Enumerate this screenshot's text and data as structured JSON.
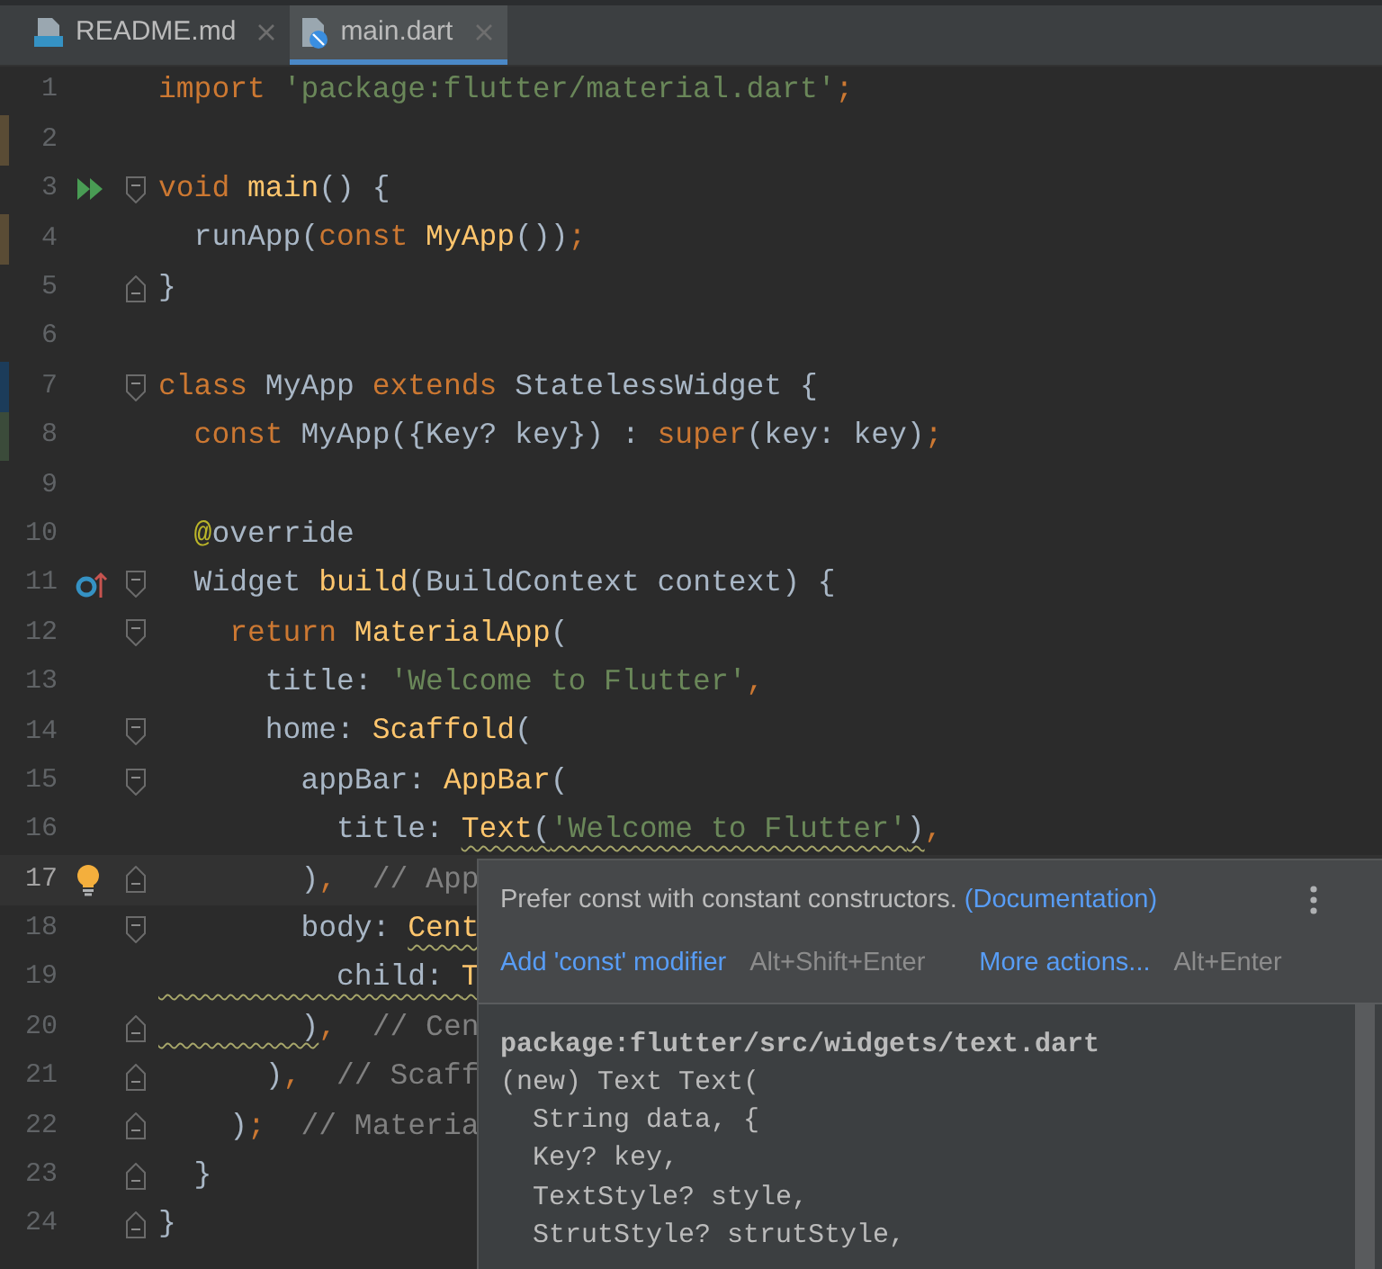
{
  "tabs": [
    {
      "label": "README.md",
      "kind": "markdown",
      "selected": false
    },
    {
      "label": "main.dart",
      "kind": "dart",
      "selected": true
    }
  ],
  "editor": {
    "lines": [
      {
        "number": "1",
        "current": false,
        "tokens": [
          {
            "text": "import ",
            "kind": "keyword"
          },
          {
            "text": "'package:flutter/material.dart'",
            "kind": "string"
          },
          {
            "text": ";",
            "kind": "keyword"
          }
        ]
      },
      {
        "number": "2",
        "current": false,
        "change_marker": {
          "color": "#5a4c35"
        }
      },
      {
        "number": "3",
        "current": false,
        "gutter_icon": {
          "kind": "run"
        },
        "fold_marker": {
          "kind": "open"
        },
        "tokens": [
          {
            "text": "void ",
            "kind": "keyword"
          },
          {
            "text": "main",
            "kind": "call"
          },
          {
            "text": "() {",
            "kind": "plain"
          }
        ]
      },
      {
        "number": "4",
        "current": false,
        "change_marker": {
          "color": "#5a4c35"
        },
        "tokens": [
          {
            "text": "  runApp(",
            "kind": "plain"
          },
          {
            "text": "const ",
            "kind": "keyword"
          },
          {
            "text": "MyApp",
            "kind": "call"
          },
          {
            "text": "())",
            "kind": "plain"
          },
          {
            "text": ";",
            "kind": "keyword"
          }
        ]
      },
      {
        "number": "5",
        "current": false,
        "fold_marker": {
          "kind": "close"
        },
        "tokens": [
          {
            "text": "}",
            "kind": "plain"
          }
        ]
      },
      {
        "number": "6",
        "current": false
      },
      {
        "number": "7",
        "current": false,
        "change_marker": {
          "color": "#1c3c5a"
        },
        "fold_marker": {
          "kind": "open"
        },
        "tokens": [
          {
            "text": "class ",
            "kind": "keyword"
          },
          {
            "text": "MyApp ",
            "kind": "plain"
          },
          {
            "text": "extends ",
            "kind": "keyword"
          },
          {
            "text": "StatelessWidget {",
            "kind": "plain"
          }
        ]
      },
      {
        "number": "8",
        "current": false,
        "change_marker": {
          "color": "#3b4b3a"
        },
        "tokens": [
          {
            "text": "  const ",
            "kind": "keyword"
          },
          {
            "text": "MyApp({Key? key}) : ",
            "kind": "plain"
          },
          {
            "text": "super",
            "kind": "keyword"
          },
          {
            "text": "(key: key)",
            "kind": "plain"
          },
          {
            "text": ";",
            "kind": "keyword"
          }
        ]
      },
      {
        "number": "9",
        "current": false
      },
      {
        "number": "10",
        "current": false,
        "tokens": [
          {
            "text": "  @",
            "kind": "annotation"
          },
          {
            "text": "override",
            "kind": "plain"
          }
        ]
      },
      {
        "number": "11",
        "current": false,
        "gutter_icon": {
          "kind": "override"
        },
        "fold_marker": {
          "kind": "open"
        },
        "tokens": [
          {
            "text": "  Widget ",
            "kind": "plain"
          },
          {
            "text": "build",
            "kind": "call"
          },
          {
            "text": "(BuildContext context) {",
            "kind": "plain"
          }
        ]
      },
      {
        "number": "12",
        "current": false,
        "fold_marker": {
          "kind": "open"
        },
        "tokens": [
          {
            "text": "    return ",
            "kind": "keyword"
          },
          {
            "text": "MaterialApp",
            "kind": "call"
          },
          {
            "text": "(",
            "kind": "plain"
          }
        ]
      },
      {
        "number": "13",
        "current": false,
        "tokens": [
          {
            "text": "      title: ",
            "kind": "plain"
          },
          {
            "text": "'Welcome to Flutter'",
            "kind": "string"
          },
          {
            "text": ",",
            "kind": "keyword"
          }
        ]
      },
      {
        "number": "14",
        "current": false,
        "fold_marker": {
          "kind": "open"
        },
        "tokens": [
          {
            "text": "      home: ",
            "kind": "plain"
          },
          {
            "text": "Scaffold",
            "kind": "call"
          },
          {
            "text": "(",
            "kind": "plain"
          }
        ]
      },
      {
        "number": "15",
        "current": false,
        "fold_marker": {
          "kind": "open"
        },
        "tokens": [
          {
            "text": "        appBar: ",
            "kind": "plain"
          },
          {
            "text": "AppBar",
            "kind": "call"
          },
          {
            "text": "(",
            "kind": "plain"
          }
        ]
      },
      {
        "number": "16",
        "current": false,
        "tokens": [
          {
            "text": "          title: ",
            "kind": "plain"
          },
          {
            "text": "Text",
            "kind": "call",
            "warning": true
          },
          {
            "text": "(",
            "kind": "plain",
            "warning": true
          },
          {
            "text": "'Welcome to Flutter'",
            "kind": "string",
            "warning": true
          },
          {
            "text": ")",
            "kind": "plain",
            "warning": true
          },
          {
            "text": ",",
            "kind": "keyword"
          }
        ]
      },
      {
        "number": "17",
        "current": true,
        "gutter_icon": {
          "kind": "bulb"
        },
        "fold_marker": {
          "kind": "close"
        },
        "tokens": [
          {
            "text": "        )",
            "kind": "plain"
          },
          {
            "text": ",",
            "kind": "keyword"
          },
          {
            "text": "  // App",
            "kind": "comment"
          }
        ]
      },
      {
        "number": "18",
        "current": false,
        "fold_marker": {
          "kind": "open"
        },
        "tokens": [
          {
            "text": "        body: ",
            "kind": "plain"
          },
          {
            "text": "Cent",
            "kind": "call",
            "warning": true
          }
        ]
      },
      {
        "number": "19",
        "current": false,
        "tokens": [
          {
            "text": "          child: ",
            "kind": "plain",
            "warning": true
          },
          {
            "text": "T",
            "kind": "call",
            "warning": true
          }
        ]
      },
      {
        "number": "20",
        "current": false,
        "fold_marker": {
          "kind": "close"
        },
        "tokens": [
          {
            "text": "        )",
            "kind": "plain",
            "warning": true
          },
          {
            "text": ",",
            "kind": "keyword"
          },
          {
            "text": "  // Cen",
            "kind": "comment"
          }
        ]
      },
      {
        "number": "21",
        "current": false,
        "fold_marker": {
          "kind": "close"
        },
        "tokens": [
          {
            "text": "      )",
            "kind": "plain"
          },
          {
            "text": ",",
            "kind": "keyword"
          },
          {
            "text": "  // Scaff",
            "kind": "comment"
          }
        ]
      },
      {
        "number": "22",
        "current": false,
        "fold_marker": {
          "kind": "close"
        },
        "tokens": [
          {
            "text": "    )",
            "kind": "plain"
          },
          {
            "text": ";",
            "kind": "keyword"
          },
          {
            "text": "  // Materia",
            "kind": "comment"
          }
        ]
      },
      {
        "number": "23",
        "current": false,
        "fold_marker": {
          "kind": "close"
        },
        "tokens": [
          {
            "text": "  }",
            "kind": "plain"
          }
        ]
      },
      {
        "number": "24",
        "current": false,
        "fold_marker": {
          "kind": "close"
        },
        "tokens": [
          {
            "text": "}",
            "kind": "plain"
          }
        ]
      }
    ]
  },
  "popup": {
    "message": "Prefer const with constant constructors. ",
    "link": "(Documentation)",
    "actions": [
      {
        "label": "Add 'const' modifier",
        "shortcut": "Alt+Shift+Enter"
      },
      {
        "label": "More actions...",
        "shortcut": "Alt+Enter"
      }
    ],
    "doc_title": "package:flutter/src/widgets/text.dart",
    "doc_lines": [
      "(new) Text Text(",
      "  String data, {",
      "  Key? key,",
      "  TextStyle? style,",
      "  StrutStyle? strutStyle,"
    ]
  }
}
